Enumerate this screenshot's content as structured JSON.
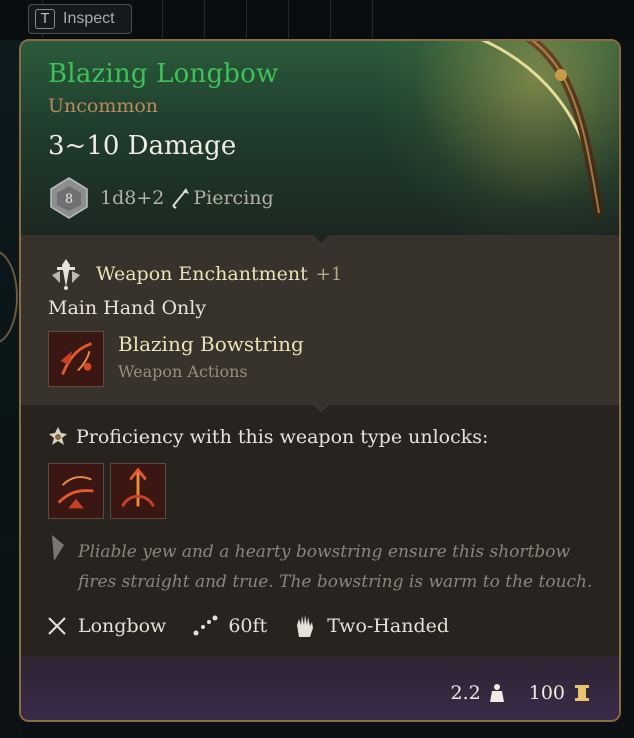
{
  "inspect": {
    "key": "T",
    "label": "Inspect"
  },
  "item": {
    "name": "Blazing Longbow",
    "rarity": "Uncommon",
    "damage": "3~10 Damage",
    "die_face": "8",
    "dice": "1d8+2",
    "damage_type": "Piercing"
  },
  "enchantment": {
    "title": "Weapon Enchantment",
    "bonus": "+1"
  },
  "main_hand": "Main Hand Only",
  "action": {
    "title": "Blazing Bowstring",
    "subtitle": "Weapon Actions"
  },
  "proficiency": {
    "label": "Proficiency with this weapon type unlocks:",
    "icons": [
      "mobile-shot-icon",
      "piercing-shot-icon"
    ]
  },
  "flavor": "Pliable yew and a hearty bowstring ensure this shortbow fires straight and true. The bowstring is warm to the touch.",
  "properties": {
    "type": "Longbow",
    "range": "60ft",
    "handedness": "Two-Handed"
  },
  "footer": {
    "weight": "2.2",
    "value": "100"
  },
  "colors": {
    "name_green": "#3cc256",
    "rarity": "#b98a5f",
    "border_gold": "#8a6d3e",
    "enchant_title": "#ede1b5"
  }
}
